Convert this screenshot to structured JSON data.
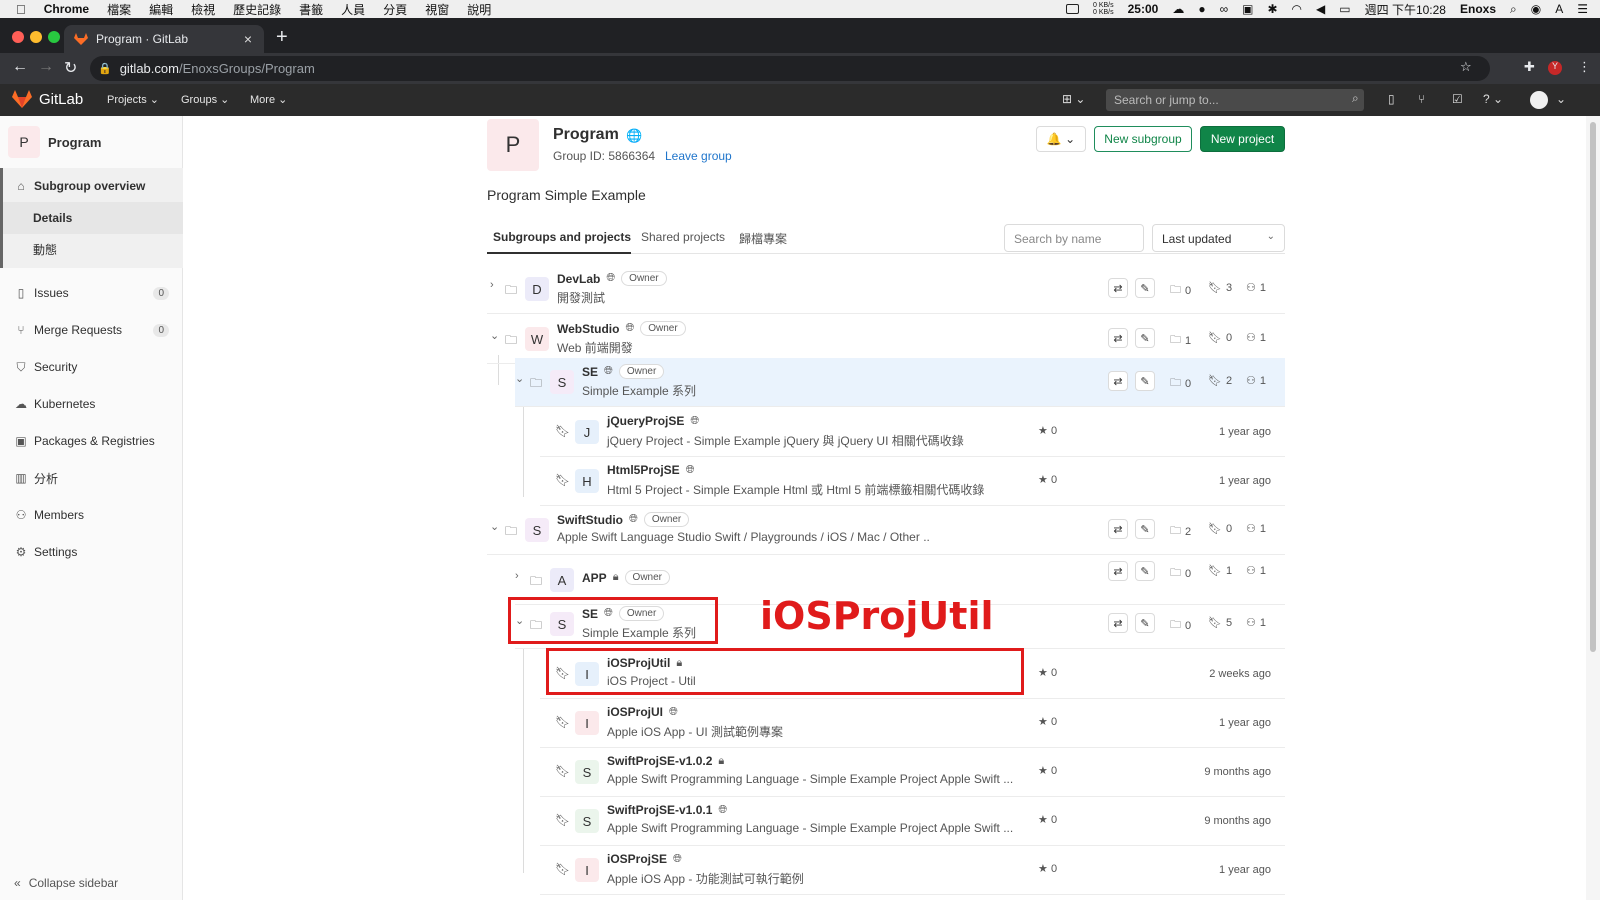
{
  "mac_menu": {
    "app": "Chrome",
    "items": [
      "檔案",
      "編輯",
      "檢視",
      "歷史記錄",
      "書籤",
      "人員",
      "分頁",
      "視窗",
      "說明"
    ],
    "net_up": "0 KB/s",
    "net_down": "0 KB/s",
    "timer": "25:00",
    "clock": "週四 下午10:28",
    "user": "Enoxs"
  },
  "browser": {
    "tab_title": "Program · GitLab",
    "url_host": "gitlab.com",
    "url_path": "/EnoxsGroups/Program"
  },
  "gitlab_header": {
    "brand": "GitLab",
    "nav": [
      "Projects",
      "Groups",
      "More"
    ],
    "search_placeholder": "Search or jump to..."
  },
  "sidebar": {
    "avatar_letter": "P",
    "title": "Program",
    "overview": "Subgroup overview",
    "sub_items": [
      "Details",
      "動態"
    ],
    "items": [
      {
        "label": "Issues",
        "icon": "issues-icon",
        "count": "0"
      },
      {
        "label": "Merge Requests",
        "icon": "merge-request-icon",
        "count": "0"
      },
      {
        "label": "Security",
        "icon": "shield-icon"
      },
      {
        "label": "Kubernetes",
        "icon": "kubernetes-icon"
      },
      {
        "label": "Packages & Registries",
        "icon": "package-icon"
      },
      {
        "label": "分析",
        "icon": "chart-icon"
      },
      {
        "label": "Members",
        "icon": "members-icon"
      },
      {
        "label": "Settings",
        "icon": "gear-icon"
      }
    ],
    "collapse": "Collapse sidebar"
  },
  "group": {
    "avatar_letter": "P",
    "name": "Program",
    "id_label": "Group ID: 5866364",
    "leave": "Leave group",
    "new_subgroup": "New subgroup",
    "new_project": "New project",
    "description": "Program Simple Example"
  },
  "tabs": {
    "items": [
      "Subgroups and projects",
      "Shared projects",
      "歸檔專案"
    ],
    "search_placeholder": "Search by name",
    "sort": "Last updated"
  },
  "rows": [
    {
      "kind": "group",
      "expand": "›",
      "letter": "D",
      "name": "DevLab",
      "vis": "globe",
      "badge": "Owner",
      "desc": "開發測試",
      "subgroups": "0",
      "projects": "3",
      "members": "1"
    },
    {
      "kind": "group",
      "expand": "⌄",
      "letter": "W",
      "name": "WebStudio",
      "vis": "globe",
      "badge": "Owner",
      "desc": "Web 前端開發",
      "subgroups": "1",
      "projects": "0",
      "members": "1"
    },
    {
      "kind": "group",
      "expand": "⌄",
      "letter": "S",
      "name": "SE",
      "vis": "globe",
      "badge": "Owner",
      "desc": "Simple Example 系列",
      "subgroups": "0",
      "projects": "2",
      "members": "1"
    },
    {
      "kind": "project",
      "letter": "J",
      "name": "jQueryProjSE",
      "vis": "globe",
      "desc": "jQuery Project - Simple Example jQuery 與 jQuery UI 相關代碼收錄",
      "stars": "0",
      "updated": "1 year ago"
    },
    {
      "kind": "project",
      "letter": "H",
      "name": "Html5ProjSE",
      "vis": "globe",
      "desc": "Html 5 Project - Simple Example Html 或 Html 5 前端標籤相關代碼收錄",
      "stars": "0",
      "updated": "1 year ago"
    },
    {
      "kind": "group",
      "expand": "⌄",
      "letter": "S",
      "name": "SwiftStudio",
      "vis": "globe",
      "badge": "Owner",
      "desc": "Apple Swift Language Studio Swift / Playgrounds / iOS / Mac / Other ..",
      "subgroups": "2",
      "projects": "0",
      "members": "1"
    },
    {
      "kind": "group",
      "expand": "›",
      "letter": "A",
      "name": "APP",
      "vis": "lock",
      "badge": "Owner",
      "desc": "",
      "subgroups": "0",
      "projects": "1",
      "members": "1"
    },
    {
      "kind": "group",
      "expand": "⌄",
      "letter": "S",
      "name": "SE",
      "vis": "globe",
      "badge": "Owner",
      "desc": "Simple Example 系列",
      "subgroups": "0",
      "projects": "5",
      "members": "1"
    },
    {
      "kind": "project",
      "letter": "I",
      "name": "iOSProjUtil",
      "vis": "lock",
      "desc": "iOS Project - Util",
      "stars": "0",
      "updated": "2 weeks ago"
    },
    {
      "kind": "project",
      "letter": "I",
      "name": "iOSProjUI",
      "vis": "globe",
      "desc": "Apple iOS App - UI 測試範例專案",
      "stars": "0",
      "updated": "1 year ago"
    },
    {
      "kind": "project",
      "letter": "S",
      "name": "SwiftProjSE-v1.0.2",
      "vis": "lock",
      "desc": "Apple Swift Programming Language - Simple Example Project Apple Swift ...",
      "stars": "0",
      "updated": "9 months ago"
    },
    {
      "kind": "project",
      "letter": "S",
      "name": "SwiftProjSE-v1.0.1",
      "vis": "globe",
      "desc": "Apple Swift Programming Language - Simple Example Project Apple Swift ...",
      "stars": "0",
      "updated": "9 months ago"
    },
    {
      "kind": "project",
      "letter": "I",
      "name": "iOSProjSE",
      "vis": "globe",
      "desc": "Apple iOS App - 功能測試可執行範例",
      "stars": "0",
      "updated": "1 year ago"
    }
  ],
  "annotation": "iOSProjUtil",
  "colors": {
    "accent_green": "#108548",
    "link_blue": "#1f75cb",
    "annotation_red": "#e01b1b",
    "highlight_row": "#eaf3fd"
  }
}
